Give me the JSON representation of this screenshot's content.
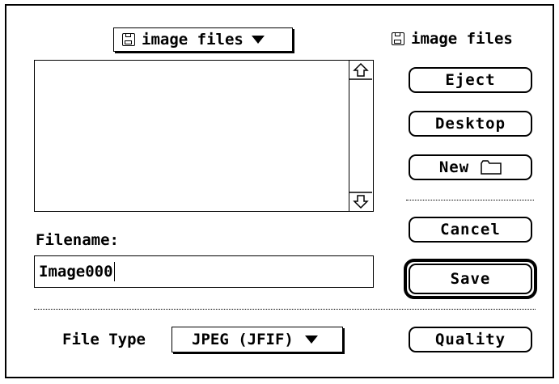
{
  "dialog": {
    "folder_popup": {
      "label": "image files",
      "icon": "floppy-disk-icon"
    },
    "volume": {
      "label": "image files",
      "icon": "floppy-disk-icon"
    },
    "file_list": {
      "items": []
    },
    "buttons": {
      "eject": "Eject",
      "desktop": "Desktop",
      "new_folder": "New",
      "cancel": "Cancel",
      "save": "Save",
      "quality": "Quality"
    },
    "filename": {
      "label": "Filename:",
      "value": "Image000"
    },
    "file_type": {
      "label": "File Type",
      "selected": "JPEG (JFIF)"
    }
  }
}
